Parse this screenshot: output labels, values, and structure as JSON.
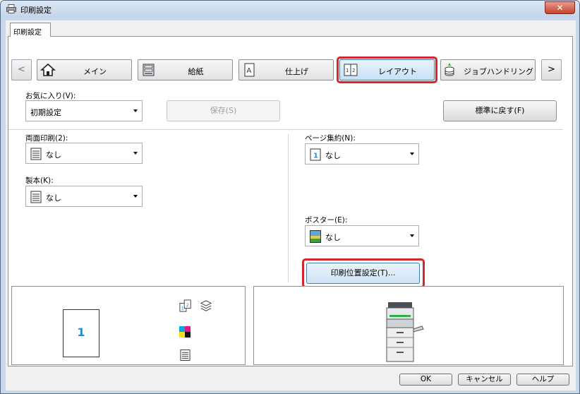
{
  "window": {
    "title": "印刷設定",
    "close_label": "✕"
  },
  "tab": {
    "label": "印刷設定"
  },
  "nav": {
    "prev": "<",
    "next": ">"
  },
  "ribbon": {
    "main": "メイン",
    "paper": "給紙",
    "finishing": "仕上げ",
    "layout": "レイアウト",
    "job_handling": "ジョブハンドリング"
  },
  "favorites": {
    "label": "お気に入り(V):",
    "value": "初期設定",
    "save_button": "保存(S)",
    "reset_button": "標準に戻す(F)"
  },
  "duplex": {
    "label": "両面印刷(2):",
    "value": "なし"
  },
  "binding": {
    "label": "製本(K):",
    "value": "なし"
  },
  "nup": {
    "label": "ページ集約(N):",
    "value": "なし",
    "icon_number": "1"
  },
  "poster": {
    "label": "ポスター(E):",
    "value": "なし"
  },
  "print_position": {
    "button": "印刷位置設定(T)..."
  },
  "preview": {
    "page_number": "1"
  },
  "footer": {
    "ok": "OK",
    "cancel": "キャンセル",
    "help": "ヘルプ"
  },
  "colors": {
    "accent_red": "#d3262e",
    "page_blue": "#1e8fd6"
  }
}
